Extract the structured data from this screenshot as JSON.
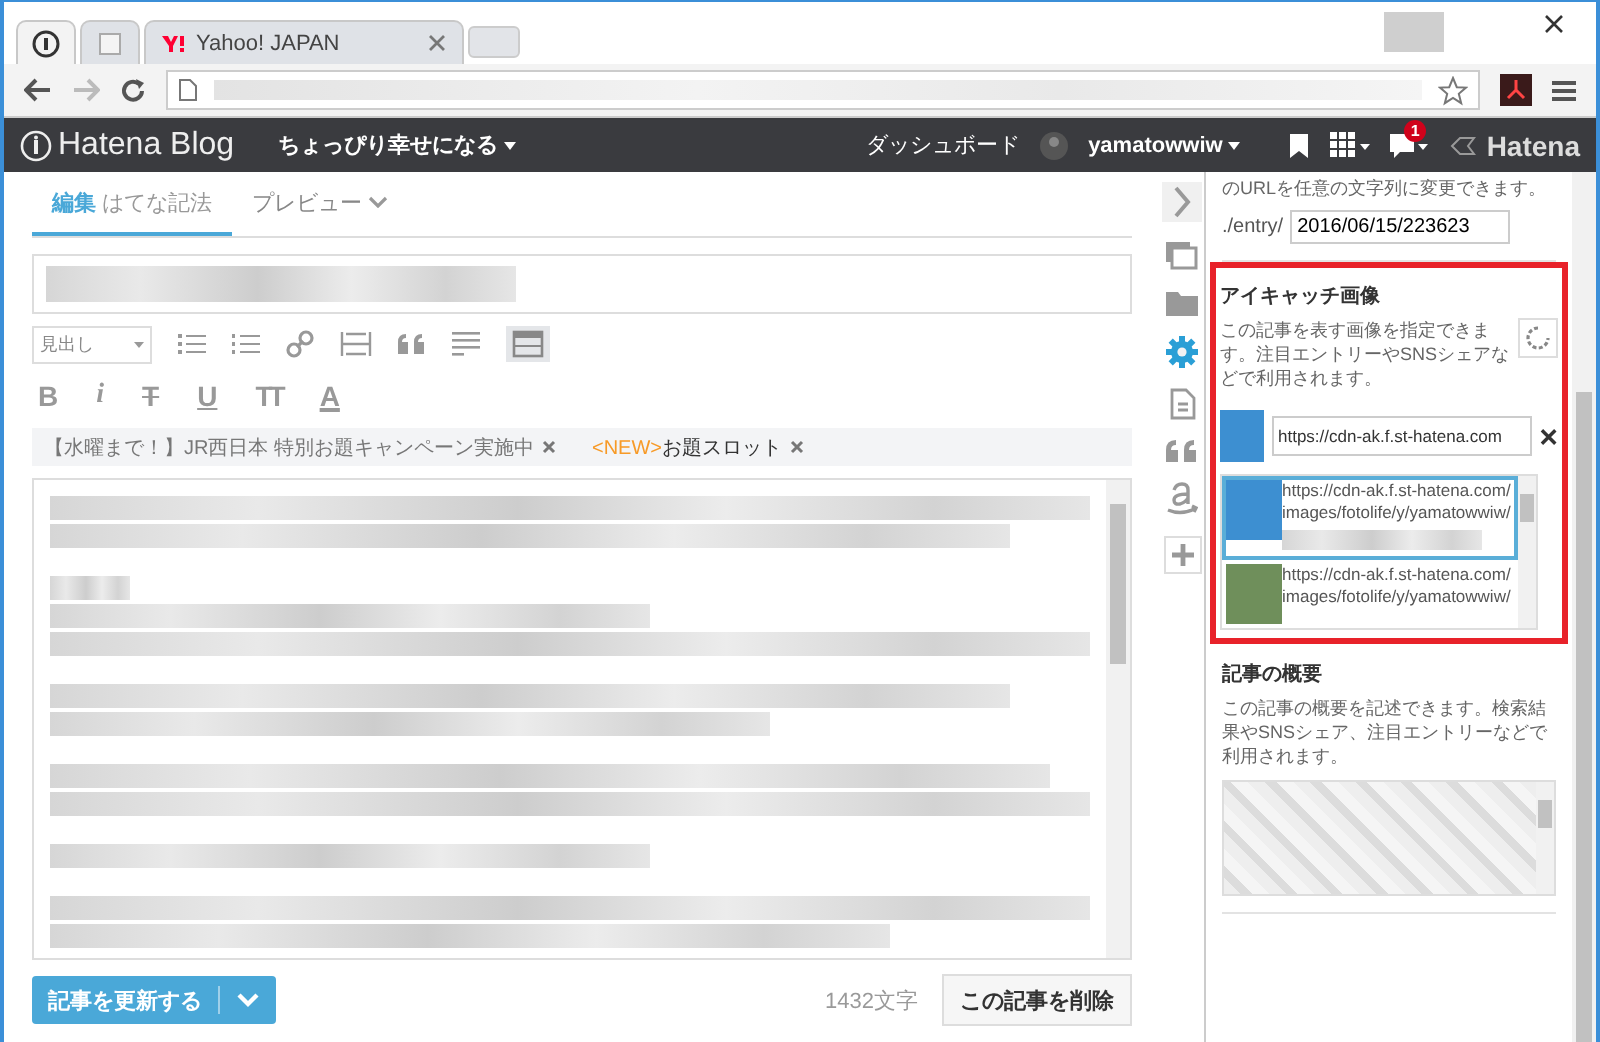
{
  "browser": {
    "tabs": [
      {
        "kind": "hatena",
        "selected": true
      },
      {
        "kind": "page",
        "selected": false
      },
      {
        "kind": "yahoo",
        "label": "Yahoo! JAPAN",
        "selected": false
      }
    ]
  },
  "header": {
    "logo": "Hatena Blog",
    "blog_title": "ちょっぴり幸せになる",
    "dashboard": "ダッシュボード",
    "user": "yamatowwiw",
    "notification_count": "1",
    "brand": "Hatena"
  },
  "editor": {
    "tabs": [
      {
        "label": "編集",
        "sub": "はてな記法",
        "selected": true
      },
      {
        "label": "プレビュー",
        "selected": false
      }
    ],
    "heading_select": "見出し",
    "format_buttons": [
      {
        "kind": "bold",
        "label": "B"
      },
      {
        "kind": "italic",
        "label": "i"
      },
      {
        "kind": "strike",
        "label": "T"
      },
      {
        "kind": "underline",
        "label": "U"
      },
      {
        "kind": "size",
        "label": "TT"
      },
      {
        "kind": "color",
        "label": "A"
      }
    ],
    "notices": [
      {
        "text": "【水曜まで！】JR西日本 特別お題キャンペーン実施中"
      },
      {
        "tag": "<NEW>",
        "text": "お題スロット"
      }
    ],
    "char_count": "1432文字",
    "update_button": "記事を更新する",
    "delete_button": "この記事を削除"
  },
  "sidebar_tools": [
    {
      "kind": "collapse",
      "selected": false
    },
    {
      "kind": "photos",
      "selected": false
    },
    {
      "kind": "folder",
      "selected": false
    },
    {
      "kind": "settings",
      "selected": true
    },
    {
      "kind": "document",
      "selected": false
    },
    {
      "kind": "quote",
      "selected": false
    },
    {
      "kind": "amazon",
      "selected": false
    },
    {
      "kind": "add",
      "selected": false
    }
  ],
  "settings_panel": {
    "url_section": {
      "description": "のURLを任意の文字列に変更できます。",
      "path_label": "./entry/",
      "value": "2016/06/15/223623"
    },
    "eyecatch": {
      "title": "アイキャッチ画像",
      "description": "この記事を表す画像を指定できます。注目エントリーやSNSシェアなどで利用されます。",
      "highlighted": true,
      "url_value": "https://cdn-ak.f.st-hatena.com",
      "candidates": [
        {
          "text": "https://cdn-ak.f.st-hatena.com/images/fotolife/y/yamatowwiw/",
          "selected": true
        },
        {
          "text": "https://cdn-ak.f.st-hatena.com/images/fotolife/y/yamatowwiw/",
          "selected": false
        }
      ]
    },
    "summary": {
      "title": "記事の概要",
      "description": "この記事の概要を記述できます。検索結果やSNSシェア、注目エントリーなどで利用されます。"
    }
  }
}
